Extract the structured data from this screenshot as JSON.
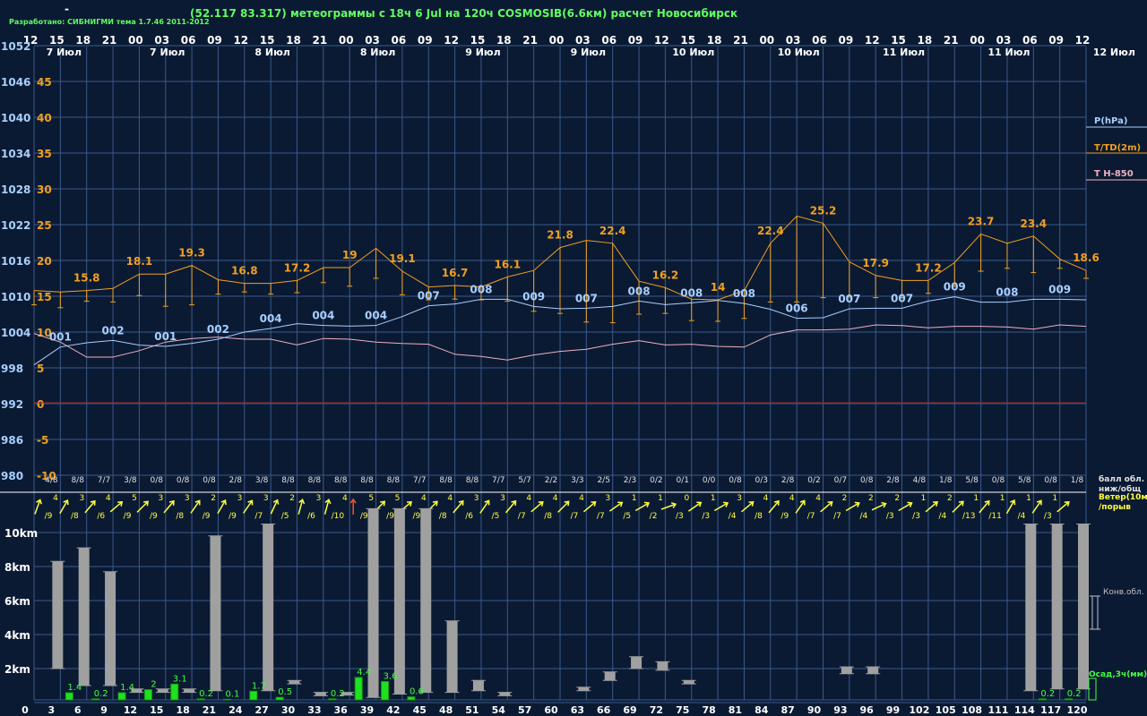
{
  "header": {
    "dash": "-",
    "developer": "Разработано: СИБНИГМИ тема 1.7.46 2011-2012",
    "title": "(52.117 83.317) метеограммы с  18ч 6 Jul на 120ч COSMOSIB(6.6км) расчет Новосибирск"
  },
  "colors": {
    "background": "#0b1a33",
    "grid": "#3a5a88",
    "temperature": "#f0a020",
    "pressure": "#a8d0ff",
    "t850": "#f0b0c0",
    "zero_line": "#a02020",
    "wind": "#ffff40",
    "wind_alt": "#ff5020",
    "cloud_bar": "#a0a0a0",
    "precip": "#20e020",
    "precip_label": "#40ff40"
  },
  "legend": {
    "pressure": "P(hPa)",
    "temperature": "T/TD(2m)",
    "t850": "T H-850",
    "cloud_fraction": "балл обл.\nниж/общ",
    "wind": "Ветер(10м)\n/порыв",
    "convective": "Конв.обл.",
    "precip": "Осад,3ч(мм)"
  },
  "time_axis": {
    "hours": [
      "12",
      "15",
      "18",
      "21",
      "00",
      "03",
      "06",
      "09",
      "12",
      "15",
      "18",
      "21",
      "00",
      "03",
      "06",
      "09",
      "12",
      "15",
      "18",
      "21",
      "00",
      "03",
      "06",
      "09",
      "12",
      "15",
      "18",
      "21",
      "00",
      "03",
      "06",
      "09",
      "12",
      "15",
      "18",
      "21",
      "00",
      "03",
      "06",
      "09",
      "12"
    ],
    "dates": [
      {
        "label": "7 Июл",
        "at": 0
      },
      {
        "label": "7 Июл",
        "at": 5
      },
      {
        "label": "8 Июл",
        "at": 9
      },
      {
        "label": "8 Июл",
        "at": 13
      },
      {
        "label": "9 Июл",
        "at": 17
      },
      {
        "label": "9 Июл",
        "at": 21
      },
      {
        "label": "10 Июл",
        "at": 25
      },
      {
        "label": "10 Июл",
        "at": 29
      },
      {
        "label": "11 Июл",
        "at": 33
      },
      {
        "label": "11 Июл",
        "at": 37
      },
      {
        "label": "12 Июл",
        "at": 41
      }
    ],
    "forecast_hours": [
      "0",
      "3",
      "6",
      "9",
      "12",
      "15",
      "18",
      "21",
      "24",
      "27",
      "30",
      "33",
      "36",
      "39",
      "42",
      "45",
      "48",
      "51",
      "54",
      "57",
      "60",
      "63",
      "66",
      "69",
      "72",
      "75",
      "78",
      "81",
      "84",
      "87",
      "90",
      "93",
      "96",
      "99",
      "102",
      "105",
      "108",
      "111",
      "114",
      "117",
      "120"
    ]
  },
  "chart_data": [
    {
      "type": "line",
      "title": "",
      "pressure_ticks": [
        "1052",
        "1046",
        "1040",
        "1034",
        "1028",
        "1022",
        "1016",
        "1010",
        "1004",
        "998",
        "992",
        "986",
        "980"
      ],
      "temperature_ticks": [
        "45",
        "40",
        "35",
        "30",
        "25",
        "20",
        "15",
        "10",
        "5",
        "0",
        "-5",
        "-10"
      ],
      "ylim_pressure": [
        980,
        1052
      ],
      "ylim_temperature": [
        -10,
        45
      ],
      "series": [
        {
          "name": "T/TD(2m)",
          "key": "temperature",
          "values": [
            15.8,
            15.6,
            15.8,
            16.1,
            18.1,
            18.1,
            19.3,
            17.3,
            16.8,
            16.8,
            17.2,
            19,
            19,
            21.7,
            18.5,
            16.3,
            16.5,
            16.3,
            17.7,
            18.6,
            21.8,
            22.8,
            22.4,
            17.1,
            16.2,
            14.6,
            14.5,
            15.8,
            22.4,
            26.2,
            25.2,
            19.8,
            17.9,
            17.2,
            17.2,
            19.7,
            23.7,
            22.4,
            23.4,
            20.2,
            18.6
          ]
        },
        {
          "name": "P(hPa)",
          "key": "pressure",
          "values": [
            998.5,
            1001.5,
            1002.2,
            1002.6,
            1001.8,
            1001.6,
            1002.1,
            1002.8,
            1004,
            1004.6,
            1005.4,
            1005.1,
            1005,
            1005.1,
            1006.6,
            1008.4,
            1008.7,
            1009.5,
            1009.5,
            1008.3,
            1007.9,
            1008,
            1008.3,
            1009.2,
            1008.6,
            1008.9,
            1009.3,
            1008.8,
            1007.8,
            1006.3,
            1006.4,
            1007.9,
            1008,
            1008,
            1009.2,
            1009.9,
            1009,
            1009,
            1009.5,
            1009.5,
            1009.4
          ]
        },
        {
          "name": "T H-850",
          "key": "t850",
          "values": [
            9.8,
            8.6,
            6.5,
            6.5,
            7.4,
            8.6,
            9.1,
            9.3,
            9,
            9,
            8.2,
            9.1,
            9,
            8.6,
            8.4,
            8.3,
            6.9,
            6.6,
            6.1,
            6.8,
            7.3,
            7.6,
            8.3,
            8.8,
            8.2,
            8.3,
            8,
            7.9,
            9.6,
            10.3,
            10.3,
            10.4,
            11,
            10.9,
            10.6,
            10.8,
            10.8,
            10.7,
            10.4,
            11,
            10.8
          ]
        }
      ],
      "temperature_labels": [
        {
          "at": 2,
          "text": "15.8"
        },
        {
          "at": 4,
          "text": "18.1"
        },
        {
          "at": 6,
          "text": "19.3"
        },
        {
          "at": 8,
          "text": "16.8"
        },
        {
          "at": 10,
          "text": "17.2"
        },
        {
          "at": 12,
          "text": "19"
        },
        {
          "at": 14,
          "text": "19.1"
        },
        {
          "at": 16,
          "text": "16.7"
        },
        {
          "at": 18,
          "text": "16.1"
        },
        {
          "at": 20,
          "text": "21.8"
        },
        {
          "at": 22,
          "text": "22.4"
        },
        {
          "at": 24,
          "text": "16.2"
        },
        {
          "at": 26,
          "text": "14"
        },
        {
          "at": 28,
          "text": "22.4"
        },
        {
          "at": 30,
          "text": "25.2"
        },
        {
          "at": 32,
          "text": "17.9"
        },
        {
          "at": 34,
          "text": "17.2"
        },
        {
          "at": 36,
          "text": "23.7"
        },
        {
          "at": 38,
          "text": "23.4"
        },
        {
          "at": 40,
          "text": "18.6"
        }
      ],
      "pressure_labels": [
        {
          "at": 1,
          "text": "001"
        },
        {
          "at": 3,
          "text": "002"
        },
        {
          "at": 5,
          "text": "001"
        },
        {
          "at": 7,
          "text": "002"
        },
        {
          "at": 9,
          "text": "004"
        },
        {
          "at": 11,
          "text": "004"
        },
        {
          "at": 13,
          "text": "004"
        },
        {
          "at": 15,
          "text": "007"
        },
        {
          "at": 17,
          "text": "008"
        },
        {
          "at": 19,
          "text": "009"
        },
        {
          "at": 21,
          "text": "007"
        },
        {
          "at": 23,
          "text": "008"
        },
        {
          "at": 25,
          "text": "008"
        },
        {
          "at": 27,
          "text": "008"
        },
        {
          "at": 29,
          "text": "006"
        },
        {
          "at": 31,
          "text": "007"
        },
        {
          "at": 33,
          "text": "007"
        },
        {
          "at": 35,
          "text": "009"
        },
        {
          "at": 37,
          "text": "008"
        },
        {
          "at": 39,
          "text": "009"
        }
      ],
      "dewpoint_depression_drops": [
        {
          "at": 0,
          "from": 15.8,
          "to": 13.8
        },
        {
          "at": 1,
          "from": 15.6,
          "to": 13.4
        },
        {
          "at": 2,
          "from": 15.8,
          "to": 14.3
        },
        {
          "at": 3,
          "from": 16.1,
          "to": 14.2
        },
        {
          "at": 4,
          "from": 18.1,
          "to": 15.1
        },
        {
          "at": 5,
          "from": 18.1,
          "to": 13.6
        },
        {
          "at": 6,
          "from": 19.3,
          "to": 13.8
        },
        {
          "at": 7,
          "from": 17.3,
          "to": 15.3
        },
        {
          "at": 8,
          "from": 16.8,
          "to": 15.6
        },
        {
          "at": 9,
          "from": 16.8,
          "to": 15.3
        },
        {
          "at": 10,
          "from": 17.2,
          "to": 15.5
        },
        {
          "at": 11,
          "from": 19,
          "to": 16.9
        },
        {
          "at": 12,
          "from": 19,
          "to": 16.4
        },
        {
          "at": 13,
          "from": 21.7,
          "to": 17.5
        },
        {
          "at": 14,
          "from": 18.5,
          "to": 15.2
        },
        {
          "at": 15,
          "from": 16.3,
          "to": 14.5
        },
        {
          "at": 16,
          "from": 16.5,
          "to": 14.6
        },
        {
          "at": 17,
          "from": 16.3,
          "to": 14.5
        },
        {
          "at": 18,
          "from": 17.7,
          "to": 14.3
        },
        {
          "at": 19,
          "from": 18.6,
          "to": 12.9
        },
        {
          "at": 20,
          "from": 21.8,
          "to": 12.6
        },
        {
          "at": 21,
          "from": 22.8,
          "to": 11.4
        },
        {
          "at": 22,
          "from": 22.4,
          "to": 11.3
        },
        {
          "at": 23,
          "from": 17.1,
          "to": 12.5
        },
        {
          "at": 24,
          "from": 16.2,
          "to": 12.6
        },
        {
          "at": 25,
          "from": 14.6,
          "to": 11.6
        },
        {
          "at": 26,
          "from": 14.5,
          "to": 11.5
        },
        {
          "at": 27,
          "from": 15.8,
          "to": 11.9
        },
        {
          "at": 28,
          "from": 22.4,
          "to": 14.2
        },
        {
          "at": 29,
          "from": 26.2,
          "to": 14.2
        },
        {
          "at": 30,
          "from": 25.2,
          "to": 14.8
        },
        {
          "at": 31,
          "from": 19.8,
          "to": 14.9
        },
        {
          "at": 32,
          "from": 17.9,
          "to": 14.8
        },
        {
          "at": 33,
          "from": 17.2,
          "to": 14.8
        },
        {
          "at": 34,
          "from": 17.2,
          "to": 15.4
        },
        {
          "at": 35,
          "from": 19.7,
          "to": 16.4
        },
        {
          "at": 36,
          "from": 23.7,
          "to": 18.5
        },
        {
          "at": 37,
          "from": 22.4,
          "to": 18.9
        },
        {
          "at": 38,
          "from": 23.4,
          "to": 18.3
        },
        {
          "at": 39,
          "from": 20.2,
          "to": 18.9
        },
        {
          "at": 40,
          "from": 18.6,
          "to": 17.5
        }
      ],
      "cloud_fraction": [
        "4/8",
        "8/8",
        "7/7",
        "3/8",
        "0/8",
        "0/8",
        "0/8",
        "2/8",
        "3/8",
        "8/8",
        "8/8",
        "8/8",
        "8/8",
        "8/8",
        "7/7",
        "8/8",
        "8/8",
        "7/7",
        "5/7",
        "2/2",
        "3/3",
        "2/5",
        "2/3",
        "0/2",
        "0/1",
        "0/0",
        "0/8",
        "0/3",
        "2/8",
        "0/2",
        "0/7",
        "0/8",
        "2/8",
        "4/8",
        "1/8",
        "5/8",
        "0/8",
        "5/8",
        "0/8",
        "1/8"
      ]
    },
    {
      "type": "table",
      "title": "",
      "wind": [
        {
          "speed": "4",
          "gust": "/9"
        },
        {
          "speed": "3",
          "gust": "/8"
        },
        {
          "speed": "4",
          "gust": "/6"
        },
        {
          "speed": "5",
          "gust": "/9"
        },
        {
          "speed": "3",
          "gust": "/9"
        },
        {
          "speed": "3",
          "gust": "/8"
        },
        {
          "speed": "2",
          "gust": "/9"
        },
        {
          "speed": "3",
          "gust": "/9"
        },
        {
          "speed": "3",
          "gust": "/7"
        },
        {
          "speed": "2",
          "gust": "/5"
        },
        {
          "speed": "3",
          "gust": "/6"
        },
        {
          "speed": "4",
          "gust": "/10"
        },
        {
          "speed": "5",
          "gust": "/9"
        },
        {
          "speed": "5",
          "gust": "/9"
        },
        {
          "speed": "4",
          "gust": "/9"
        },
        {
          "speed": "4",
          "gust": "/8"
        },
        {
          "speed": "3",
          "gust": "/6"
        },
        {
          "speed": "3",
          "gust": "/5"
        },
        {
          "speed": "4",
          "gust": "/7"
        },
        {
          "speed": "4",
          "gust": "/8"
        },
        {
          "speed": "4",
          "gust": "/7"
        },
        {
          "speed": "3",
          "gust": "/7"
        },
        {
          "speed": "1",
          "gust": "/5"
        },
        {
          "speed": "1",
          "gust": "/2"
        },
        {
          "speed": "0",
          "gust": "/3"
        },
        {
          "speed": "1",
          "gust": "/3"
        },
        {
          "speed": "3",
          "gust": "/4"
        },
        {
          "speed": "4",
          "gust": "/8"
        },
        {
          "speed": "4",
          "gust": "/9"
        },
        {
          "speed": "4",
          "gust": "/7"
        },
        {
          "speed": "2",
          "gust": "/7"
        },
        {
          "speed": "2",
          "gust": "/4"
        },
        {
          "speed": "2",
          "gust": "/3"
        },
        {
          "speed": "1",
          "gust": "/3"
        },
        {
          "speed": "2",
          "gust": "/4"
        },
        {
          "speed": "1",
          "gust": "/13"
        },
        {
          "speed": "1",
          "gust": "/11"
        },
        {
          "speed": "1",
          "gust": "/4"
        },
        {
          "speed": "1",
          "gust": "/3"
        }
      ],
      "wind_arrow_dirs": [
        200,
        210,
        220,
        230,
        225,
        220,
        215,
        210,
        215,
        205,
        195,
        195,
        180,
        225,
        230,
        225,
        220,
        215,
        220,
        230,
        225,
        230,
        235,
        240,
        250,
        235,
        240,
        230,
        220,
        215,
        230,
        240,
        245,
        240,
        230,
        225,
        220,
        210,
        215,
        230
      ],
      "wind_arrow_alt_index": [
        12
      ]
    },
    {
      "type": "bar",
      "title": "",
      "height_ticks": [
        "10km",
        "8km",
        "6km",
        "4km",
        "2km"
      ],
      "ylim": [
        0,
        11.8
      ],
      "convective_clouds": [
        {
          "at": 1,
          "base": 2.0,
          "top": 8.3
        },
        {
          "at": 2,
          "base": 1.0,
          "top": 9.1
        },
        {
          "at": 3,
          "base": 1.0,
          "top": 7.7
        },
        {
          "at": 4,
          "base": 0.6,
          "top": 0.8
        },
        {
          "at": 5,
          "base": 0.6,
          "top": 0.8
        },
        {
          "at": 6,
          "base": 0.6,
          "top": 0.8
        },
        {
          "at": 7,
          "base": 0.7,
          "top": 9.8
        },
        {
          "at": 9,
          "base": 0.7,
          "top": 10.5
        },
        {
          "at": 10,
          "base": 1.1,
          "top": 1.3
        },
        {
          "at": 11,
          "base": 0.4,
          "top": 0.6
        },
        {
          "at": 12,
          "base": 0.5,
          "top": 0.6
        },
        {
          "at": 13,
          "base": 0.3,
          "top": 11.4
        },
        {
          "at": 14,
          "base": 0.5,
          "top": 11.4
        },
        {
          "at": 15,
          "base": 0.6,
          "top": 11.4
        },
        {
          "at": 16,
          "base": 0.6,
          "top": 4.8
        },
        {
          "at": 17,
          "base": 0.7,
          "top": 1.3
        },
        {
          "at": 18,
          "base": 0.4,
          "top": 0.6
        },
        {
          "at": 21,
          "base": 0.7,
          "top": 0.9
        },
        {
          "at": 22,
          "base": 1.3,
          "top": 1.8
        },
        {
          "at": 23,
          "base": 2.0,
          "top": 2.7
        },
        {
          "at": 24,
          "base": 1.9,
          "top": 2.4
        },
        {
          "at": 25,
          "base": 1.1,
          "top": 1.3
        },
        {
          "at": 31,
          "base": 1.7,
          "top": 2.1
        },
        {
          "at": 32,
          "base": 1.7,
          "top": 2.1
        },
        {
          "at": 38,
          "base": 0.7,
          "top": 10.5
        },
        {
          "at": 39,
          "base": 0.8,
          "top": 10.5
        },
        {
          "at": 40,
          "base": 0.8,
          "top": 10.5
        }
      ],
      "precipitation_mm": [
        {
          "at": 1,
          "value": 1.4,
          "label": "1.4"
        },
        {
          "at": 2,
          "value": 0.2,
          "label": "0.2"
        },
        {
          "at": 3,
          "value": 1.4,
          "label": "1.4"
        },
        {
          "at": 4,
          "value": 2.0,
          "label": "2"
        },
        {
          "at": 5,
          "value": 3.1,
          "label": "3.1"
        },
        {
          "at": 6,
          "value": 0.2,
          "label": "0.2"
        },
        {
          "at": 7,
          "value": 0.1,
          "label": "0.1"
        },
        {
          "at": 8,
          "value": 1.7,
          "label": "1.7"
        },
        {
          "at": 9,
          "value": 0.5,
          "label": "0.5"
        },
        {
          "at": 11,
          "value": 0.2,
          "label": "0.2"
        },
        {
          "at": 12,
          "value": 4.4,
          "label": "4.4"
        },
        {
          "at": 13,
          "value": 3.6,
          "label": "3.6"
        },
        {
          "at": 14,
          "value": 0.6,
          "label": "0.6"
        },
        {
          "at": 38,
          "value": 0.2,
          "label": "0.2"
        },
        {
          "at": 39,
          "value": 0.2,
          "label": "0.2"
        }
      ]
    }
  ]
}
